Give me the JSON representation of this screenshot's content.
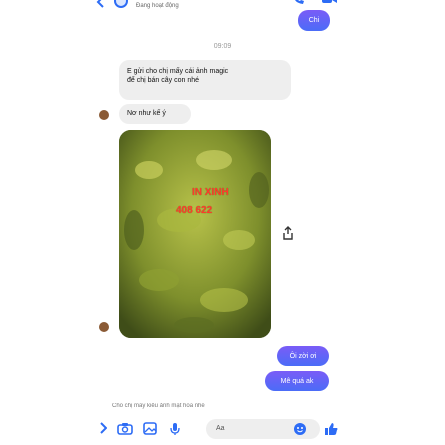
{
  "header": {
    "status": "Đang hoạt động",
    "back_icon": "chevron-left-icon",
    "call_icon": "phone-icon",
    "video_icon": "video-camera-icon",
    "accent": "#2d6cf5"
  },
  "messages": {
    "chi": "Chi",
    "time": "09:09",
    "magic_line1": "E gửi cho chị mấy cái ảnh magic",
    "magic_line2": "để chị bán cây con nhé",
    "vi": "Nơ như kế ý",
    "photo_watermark_1": "IN XINH",
    "photo_watermark_2": "408 622",
    "oi": "Ôi zời ơi",
    "meqa": "Mê quá ak",
    "preview": "Cho chị mấy kiểu ảnh mặt hoa nhé"
  },
  "composer": {
    "placeholder": "Aa",
    "icons": [
      "chevron-right-icon",
      "camera-icon",
      "image-icon",
      "microphone-icon",
      "emoji-icon",
      "thumbs-up-icon"
    ]
  },
  "colors": {
    "bubble_out_top": "#7a5cf7",
    "bubble_out_bottom": "#4b6cf7",
    "bubble_in": "#eeeeee",
    "watermark": "#ff3a2a"
  }
}
